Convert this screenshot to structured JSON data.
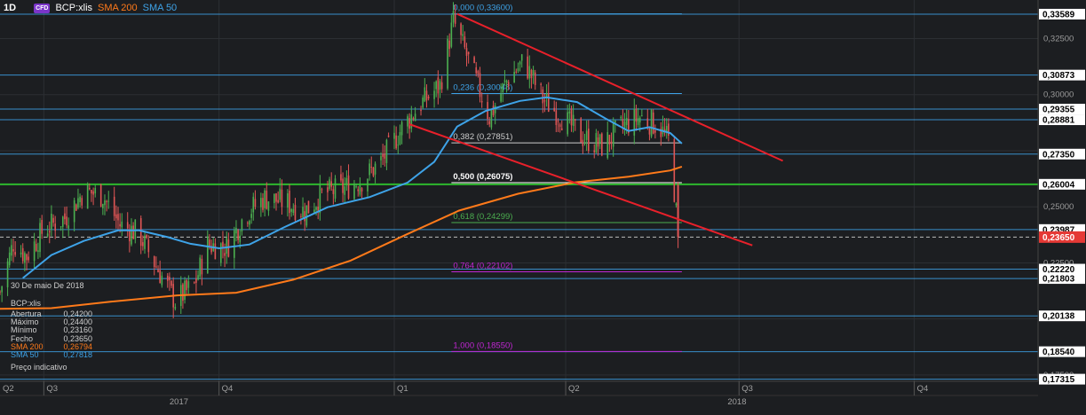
{
  "header": {
    "timeframe": "1D",
    "cfd_badge": "CFD",
    "symbol": "BCP:xlis",
    "sma200_label": "SMA 200",
    "sma50_label": "SMA 50"
  },
  "ohlc_panel": {
    "date": "30 De maio De 2018",
    "symbol": "BCP:xlis",
    "rows": [
      {
        "label": "Abertura",
        "value": "0,24200"
      },
      {
        "label": "Máximo",
        "value": "0,24400"
      },
      {
        "label": "Mínimo",
        "value": "0,23160"
      },
      {
        "label": "Fecho",
        "value": "0,23650"
      },
      {
        "label": "SMA 200",
        "value": "0,26794"
      },
      {
        "label": "SMA 50",
        "value": "0,27818"
      }
    ],
    "indicative": "Preço indicativo"
  },
  "colors": {
    "background": "#1c1e21",
    "up_candle": "#4caf50",
    "down_candle": "#e05555",
    "sma200": "#ff7a1a",
    "sma50": "#3ea3e8",
    "hline": "#3ea3e8",
    "green_level": "#2db82d",
    "trend": "#e8202a",
    "fib_purple": "#c026d3",
    "last_price": "#e53935"
  },
  "chart_data": {
    "type": "candlestick",
    "title": "",
    "xlabel": "",
    "ylabel": "",
    "x_range": [
      "2017-06-08",
      "2018-12-05"
    ],
    "ylim": [
      0.1722,
      0.3422
    ],
    "grid": true,
    "x_ticks": [
      {
        "label": "Q2",
        "date": "2017-06-08"
      },
      {
        "label": "Q3",
        "date": "2017-07-01"
      },
      {
        "label": "Q4",
        "date": "2017-10-01"
      },
      {
        "label": "Q1",
        "date": "2018-01-01"
      },
      {
        "label": "Q2",
        "date": "2018-04-01"
      },
      {
        "label": "Q3",
        "date": "2018-07-01"
      },
      {
        "label": "Q4",
        "date": "2018-10-01"
      }
    ],
    "x_years": [
      {
        "label": "2017",
        "date": "2017-09-05"
      },
      {
        "label": "2018",
        "date": "2018-06-25"
      }
    ],
    "y_ticks": [
      {
        "label": "0,32500",
        "value": 0.325
      },
      {
        "label": "0,30000",
        "value": 0.3
      },
      {
        "label": "0,25000",
        "value": 0.25
      },
      {
        "label": "0,22500",
        "value": 0.225
      },
      {
        "label": "0,17500",
        "value": 0.175
      }
    ],
    "horizontal_levels": [
      {
        "label": "0,33589",
        "value": 0.33589,
        "style": "blue"
      },
      {
        "label": "0,30873",
        "value": 0.30873,
        "style": "blue"
      },
      {
        "label": "0,29355",
        "value": 0.29355,
        "style": "blue"
      },
      {
        "label": "0,28881",
        "value": 0.28881,
        "style": "blue"
      },
      {
        "label": "0,27350",
        "value": 0.2735,
        "style": "blue"
      },
      {
        "label": "0,26004",
        "value": 0.26004,
        "style": "green"
      },
      {
        "label": "0,23987",
        "value": 0.23987,
        "style": "blue"
      },
      {
        "label": "0,22220",
        "value": 0.2222,
        "style": "blue"
      },
      {
        "label": "0,21803",
        "value": 0.21803,
        "style": "blue"
      },
      {
        "label": "0,20138",
        "value": 0.20138,
        "style": "blue"
      },
      {
        "label": "0,18540",
        "value": 0.1854,
        "style": "blue"
      },
      {
        "label": "0,17315",
        "value": 0.17315,
        "style": "blue"
      }
    ],
    "last_price": {
      "label": "0,23650",
      "value": 0.2365
    },
    "fibonacci": {
      "x_start": "2018-01-31",
      "x_end": "2018-06-01",
      "levels": [
        {
          "label": "0,000 (0,33600)",
          "value": 0.336,
          "color": "#3ea3e8"
        },
        {
          "label": "0,236 (0,30048)",
          "value": 0.30048,
          "color": "#3ea3e8"
        },
        {
          "label": "0,382 (0,27851)",
          "value": 0.27851,
          "color": "#cccccc"
        },
        {
          "label": "0,500 (0,26075)",
          "value": 0.26075,
          "color": "#ffffff"
        },
        {
          "label": "0,618 (0,24299)",
          "value": 0.24299,
          "color": "#4caf50"
        },
        {
          "label": "0,764 (0,22102)",
          "value": 0.22102,
          "color": "#c026d3"
        },
        {
          "label": "1,000 (0,18550)",
          "value": 0.1855,
          "color": "#c026d3"
        }
      ]
    },
    "trend_lines": [
      {
        "from": {
          "date": "2018-02-03",
          "value": 0.336
        },
        "to": {
          "date": "2018-07-24",
          "value": 0.2705
        }
      },
      {
        "from": {
          "date": "2018-01-09",
          "value": 0.2868
        },
        "to": {
          "date": "2018-07-08",
          "value": 0.2328
        }
      }
    ],
    "sma200": {
      "name": "SMA 200",
      "dates": [
        "2017-06-08",
        "2017-07-05",
        "2017-08-06",
        "2017-09-09",
        "2017-10-10",
        "2017-11-09",
        "2017-12-09",
        "2018-01-07",
        "2018-02-04",
        "2018-03-07",
        "2018-04-06",
        "2018-05-04",
        "2018-05-26",
        "2018-06-01"
      ],
      "values": [
        0.2045,
        0.2048,
        0.2078,
        0.2105,
        0.2117,
        0.2175,
        0.226,
        0.2375,
        0.2483,
        0.2558,
        0.2609,
        0.2634,
        0.2662,
        0.2679
      ]
    },
    "sma50": {
      "name": "SMA 50",
      "dates": [
        "2017-06-20",
        "2017-07-05",
        "2017-07-22",
        "2017-08-09",
        "2017-08-20",
        "2017-09-04",
        "2017-09-16",
        "2017-10-01",
        "2017-10-17",
        "2017-11-04",
        "2017-11-27",
        "2017-12-19",
        "2018-01-08",
        "2018-01-22",
        "2018-02-03",
        "2018-02-18",
        "2018-03-08",
        "2018-03-22",
        "2018-04-07",
        "2018-04-22",
        "2018-05-04",
        "2018-05-15",
        "2018-05-26",
        "2018-06-01"
      ],
      "values": [
        0.2182,
        0.2285,
        0.2348,
        0.2395,
        0.2395,
        0.2365,
        0.2335,
        0.2315,
        0.2332,
        0.2408,
        0.2498,
        0.2543,
        0.2608,
        0.27,
        0.2858,
        0.2928,
        0.2972,
        0.2988,
        0.2967,
        0.2893,
        0.2838,
        0.2855,
        0.2828,
        0.2782
      ]
    },
    "close_path": {
      "dates": [
        "2017-06-08",
        "2017-06-15",
        "2017-06-22",
        "2017-07-01",
        "2017-07-12",
        "2017-07-22",
        "2017-08-01",
        "2017-08-10",
        "2017-08-20",
        "2017-08-30",
        "2017-09-08",
        "2017-09-18",
        "2017-09-25",
        "2017-10-05",
        "2017-10-15",
        "2017-10-25",
        "2017-11-05",
        "2017-11-15",
        "2017-11-25",
        "2017-12-05",
        "2017-12-15",
        "2017-12-25",
        "2018-01-05",
        "2018-01-15",
        "2018-01-25",
        "2018-02-01",
        "2018-02-10",
        "2018-02-20",
        "2018-03-01",
        "2018-03-10",
        "2018-03-20",
        "2018-03-30",
        "2018-04-10",
        "2018-04-20",
        "2018-05-01",
        "2018-05-10",
        "2018-05-20",
        "2018-05-26",
        "2018-05-30"
      ],
      "values": [
        0.212,
        0.234,
        0.228,
        0.24,
        0.245,
        0.257,
        0.255,
        0.242,
        0.238,
        0.222,
        0.208,
        0.215,
        0.233,
        0.232,
        0.247,
        0.254,
        0.252,
        0.248,
        0.256,
        0.258,
        0.262,
        0.27,
        0.285,
        0.296,
        0.304,
        0.333,
        0.313,
        0.29,
        0.306,
        0.315,
        0.298,
        0.29,
        0.281,
        0.277,
        0.286,
        0.29,
        0.286,
        0.278,
        0.2365
      ]
    }
  }
}
